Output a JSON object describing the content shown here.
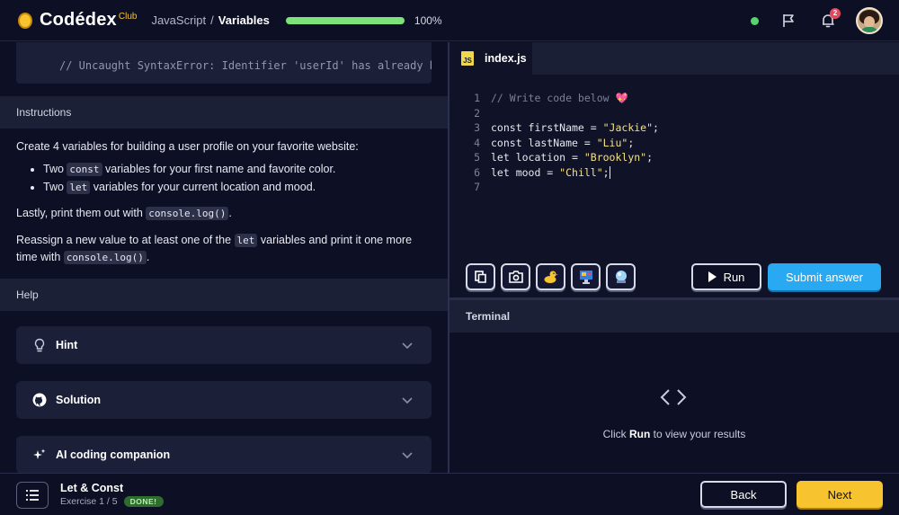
{
  "header": {
    "logo_text": "Codédex",
    "logo_club": "Club",
    "breadcrumb_course": "JavaScript",
    "breadcrumb_sep": "/",
    "breadcrumb_lesson": "Variables",
    "progress_fraction": 1.0,
    "progress_label": "100%",
    "notification_count": "2"
  },
  "left": {
    "error_line": "// Uncaught SyntaxError: Identifier 'userId' has already been declared",
    "instructions_title": "Instructions",
    "intro": "Create 4 variables for building a user profile on your favorite website:",
    "bullet1_pre": "Two",
    "bullet1_code": "const",
    "bullet1_post": "variables for your first name and favorite color.",
    "bullet2_pre": "Two",
    "bullet2_code": "let",
    "bullet2_post": "variables for your current location and mood.",
    "lastly_pre": "Lastly, print them out with",
    "lastly_code": "console.log()",
    "lastly_post": ".",
    "reassign_pre": "Reassign a new value to at least one of the",
    "reassign_code1": "let",
    "reassign_mid": "variables and print it one more time with",
    "reassign_code2": "console.log()",
    "reassign_post": ".",
    "help_title": "Help",
    "hint_label": "Hint",
    "solution_label": "Solution",
    "ai_label": "AI coding companion"
  },
  "editor": {
    "tab_label": "index.js",
    "js_badge": "JS",
    "lines": [
      {
        "n": "1",
        "comment": "// Write code below 💖"
      },
      {
        "n": "2"
      },
      {
        "n": "3",
        "kw": "const firstName = ",
        "str": "\"Jackie\"",
        "end": ";"
      },
      {
        "n": "4",
        "kw": "const lastName = ",
        "str": "\"Liu\"",
        "end": ";"
      },
      {
        "n": "5",
        "kw": "let location = ",
        "str": "\"Brooklyn\"",
        "end": ";"
      },
      {
        "n": "6",
        "kw": "let mood = ",
        "str": "\"Chill\"",
        "end": ";"
      },
      {
        "n": "7"
      }
    ],
    "run_label": "Run",
    "submit_label": "Submit answer"
  },
  "terminal": {
    "title": "Terminal",
    "msg_pre": "Click",
    "msg_bold": "Run",
    "msg_post": "to view your results"
  },
  "footer": {
    "lesson_title": "Let & Const",
    "exercise": "Exercise 1 / 5",
    "done_badge": "DONE!",
    "back_label": "Back",
    "next_label": "Next"
  },
  "colors": {
    "background": "#0d1024",
    "accent_blue": "#29a9f1",
    "accent_yellow": "#f7c32e",
    "progress_green": "#7be37a"
  }
}
